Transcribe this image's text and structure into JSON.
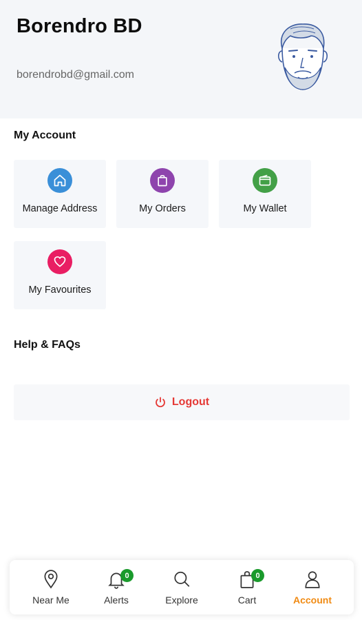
{
  "profile": {
    "name": "Borendro BD",
    "email": "borendrobd@gmail.com"
  },
  "sections": {
    "my_account": "My Account",
    "help": "Help & FAQs"
  },
  "tiles": [
    {
      "label": "Manage Address",
      "icon": "home-icon",
      "color": "#3a8fd8"
    },
    {
      "label": "My Orders",
      "icon": "shopping-bag-icon",
      "color": "#8e44ad"
    },
    {
      "label": "My Wallet",
      "icon": "wallet-icon",
      "color": "#43a047"
    },
    {
      "label": "My Favourites",
      "icon": "heart-icon",
      "color": "#e91e63"
    }
  ],
  "logout": {
    "label": "Logout",
    "icon": "power-icon",
    "color": "#e53935"
  },
  "nav": {
    "items": [
      {
        "label": "Near Me",
        "icon": "location-pin-icon"
      },
      {
        "label": "Alerts",
        "icon": "bell-icon",
        "badge": "0"
      },
      {
        "label": "Explore",
        "icon": "search-icon"
      },
      {
        "label": "Cart",
        "icon": "shopping-bag-icon",
        "badge": "0"
      },
      {
        "label": "Account",
        "icon": "user-icon",
        "active": true
      }
    ],
    "active_color": "#f08a12",
    "badge_color": "#1a9a2c"
  }
}
